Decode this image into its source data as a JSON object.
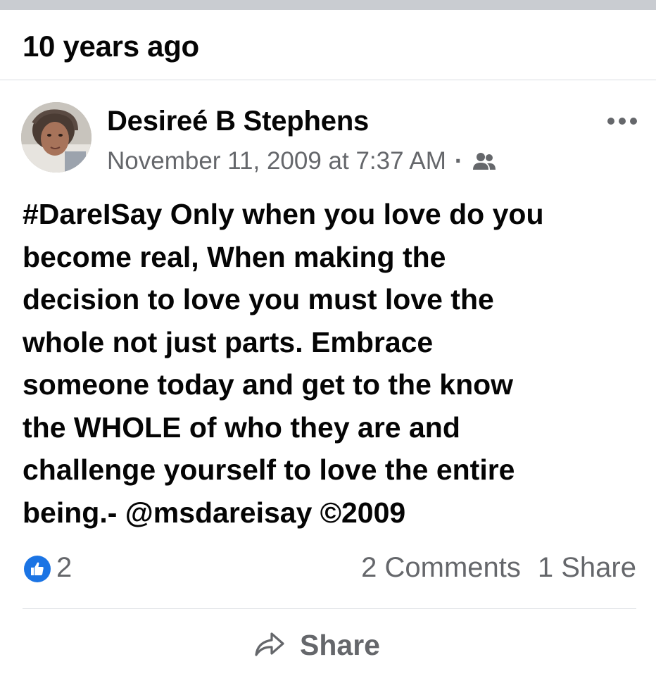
{
  "memory": {
    "title": "10 years ago"
  },
  "post": {
    "author": "Desireé B Stephens",
    "timestamp": "November 11, 2009 at 7:37 AM",
    "separator": "·",
    "audience_icon": "friends-icon",
    "text": "#DareISay Only when you love do you\nbecome real, When making the\ndecision to love you must love the\nwhole not just parts. Embrace\nsomeone today and get to the know\nthe WHOLE of who they are and\nchallenge yourself to love the entire\nbeing.- @msdareisay ©2009"
  },
  "engagement": {
    "likes": "2",
    "comments": "2 Comments",
    "shares": "1 Share"
  },
  "actions": {
    "share_label": "Share"
  },
  "colors": {
    "primary_text": "#050505",
    "secondary_text": "#65676b",
    "like_blue": "#1b74e4",
    "divider": "#dadde1"
  }
}
